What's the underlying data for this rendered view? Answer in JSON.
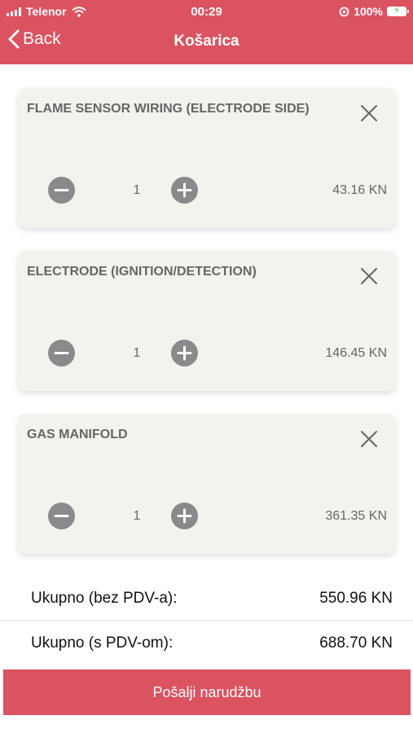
{
  "status_bar": {
    "carrier": "Telenor",
    "time": "00:29",
    "battery": "100%"
  },
  "nav": {
    "back_label": "Back",
    "title": "Košarica"
  },
  "cart_items": [
    {
      "name": "FLAME SENSOR WIRING (ELECTRODE SIDE)",
      "quantity": "1",
      "price": "43.16 KN"
    },
    {
      "name": "ELECTRODE (IGNITION/DETECTION)",
      "quantity": "1",
      "price": "146.45 KN"
    },
    {
      "name": "GAS MANIFOLD",
      "quantity": "1",
      "price": "361.35 KN"
    }
  ],
  "totals": {
    "net_label": "Ukupno (bez PDV-a):",
    "net_value": "550.96 KN",
    "gross_label": "Ukupno (s PDV-om):",
    "gross_value": "688.70 KN"
  },
  "submit_label": "Pošalji narudžbu",
  "colors": {
    "accent": "#db5261",
    "card_background": "#f3f2ed",
    "stepper_button": "#8a8a8c",
    "battery_charging": "#45c34a"
  },
  "icons": [
    "wifi-icon",
    "alarm-icon",
    "battery-icon",
    "chevron-left-icon",
    "close-icon",
    "minus-icon",
    "plus-icon"
  ]
}
